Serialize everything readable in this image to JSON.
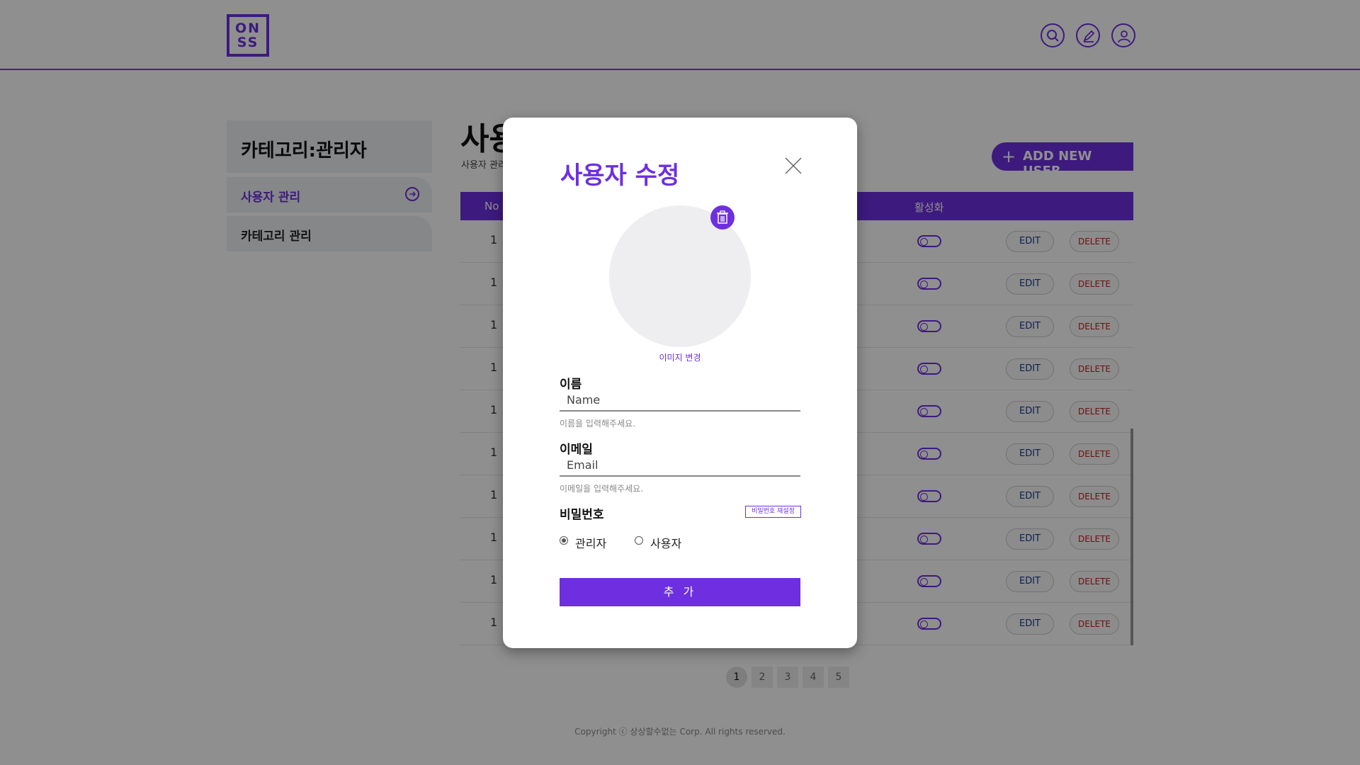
{
  "header": {
    "logo_line1": "ON",
    "logo_line2": "SS",
    "icons": [
      "search-icon",
      "pencil-icon",
      "user-icon"
    ]
  },
  "sidebar": {
    "title": "카테고리:관리자",
    "items": [
      {
        "label": "사용자 관리",
        "active": true
      },
      {
        "label": "카테고리 관리",
        "active": false
      }
    ]
  },
  "main": {
    "title": "사용",
    "subtitle": "사용자 관리",
    "add_button": "ADD NEW USER.",
    "columns": {
      "no": "No",
      "active": "활성화"
    },
    "rows": [
      {
        "no": "1",
        "edit": "EDIT",
        "delete": "DELETE"
      },
      {
        "no": "1",
        "edit": "EDIT",
        "delete": "DELETE"
      },
      {
        "no": "1",
        "edit": "EDIT",
        "delete": "DELETE"
      },
      {
        "no": "1",
        "edit": "EDIT",
        "delete": "DELETE"
      },
      {
        "no": "1",
        "edit": "EDIT",
        "delete": "DELETE"
      },
      {
        "no": "1",
        "edit": "EDIT",
        "delete": "DELETE"
      },
      {
        "no": "1",
        "edit": "EDIT",
        "delete": "DELETE"
      },
      {
        "no": "1",
        "edit": "EDIT",
        "delete": "DELETE"
      },
      {
        "no": "1",
        "edit": "EDIT",
        "delete": "DELETE"
      },
      {
        "no": "1",
        "edit": "EDIT",
        "delete": "DELETE"
      }
    ],
    "pagination": [
      "1",
      "2",
      "3",
      "4",
      "5"
    ],
    "current_page": "1"
  },
  "footer": {
    "copyright": "Copyright ⓒ 상상할수없는 Corp. All rights reserved."
  },
  "modal": {
    "title": "사용자 수정",
    "image_change": "이미지 변경",
    "name_label": "이름",
    "name_placeholder": "Name",
    "name_help": "이름을 입력해주세요.",
    "email_label": "이메일",
    "email_placeholder": "Email",
    "email_help": "이메일을 입력해주세요.",
    "password_label": "비밀번호",
    "password_reset": "비밀번호 재설정",
    "role_admin": "관리자",
    "role_user": "사용자",
    "role_selected": "관리자",
    "submit": "추 가"
  },
  "colors": {
    "accent": "#6e2fe0",
    "edit_text": "#1d3b8f",
    "delete_text": "#c21d1d",
    "overlay": "rgba(0,0,0,0.44)"
  }
}
